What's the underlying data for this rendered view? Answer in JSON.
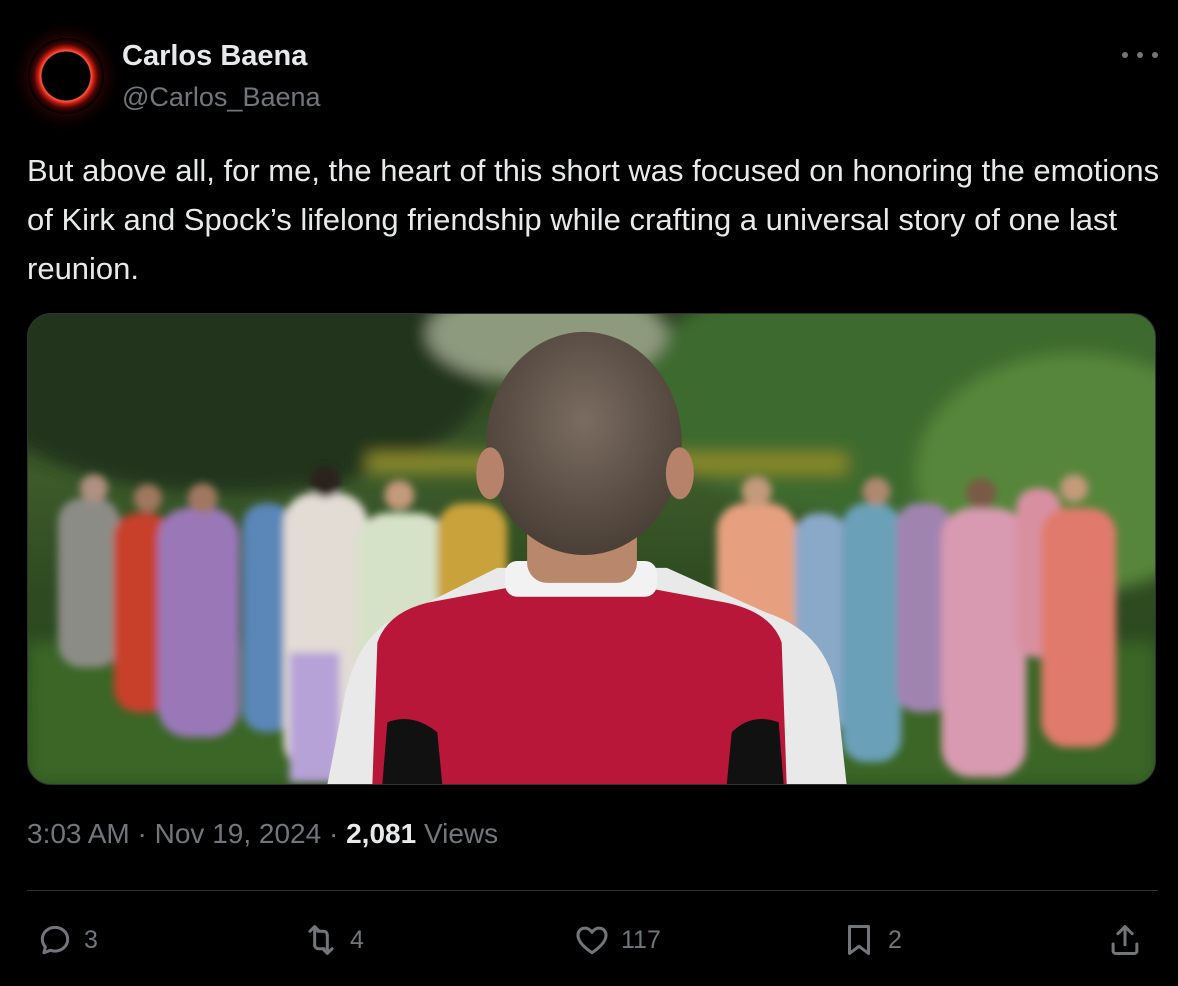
{
  "user": {
    "name": "Carlos Baena",
    "handle": "@Carlos_Baena"
  },
  "tweet": {
    "text": "But above all, for me, the heart of this short was focused on honoring the emotions of Kirk and Spock’s lifelong friendship while crafting a universal story of one last reunion.",
    "media_icon": "photo"
  },
  "meta": {
    "time": "3:03 AM",
    "sep1": "·",
    "date": "Nov 19, 2024",
    "sep2": "·",
    "views_count": "2,081",
    "views_label": "Views"
  },
  "actions": {
    "replies": "3",
    "reposts": "4",
    "likes": "117",
    "bookmarks": "2"
  },
  "icons": [
    "more-icon",
    "reply-icon",
    "repost-icon",
    "like-icon",
    "bookmark-icon",
    "share-icon"
  ],
  "colors": {
    "background": "#000000",
    "text": "#e7e9ea",
    "secondary": "#71767b",
    "border": "#2f3336"
  }
}
